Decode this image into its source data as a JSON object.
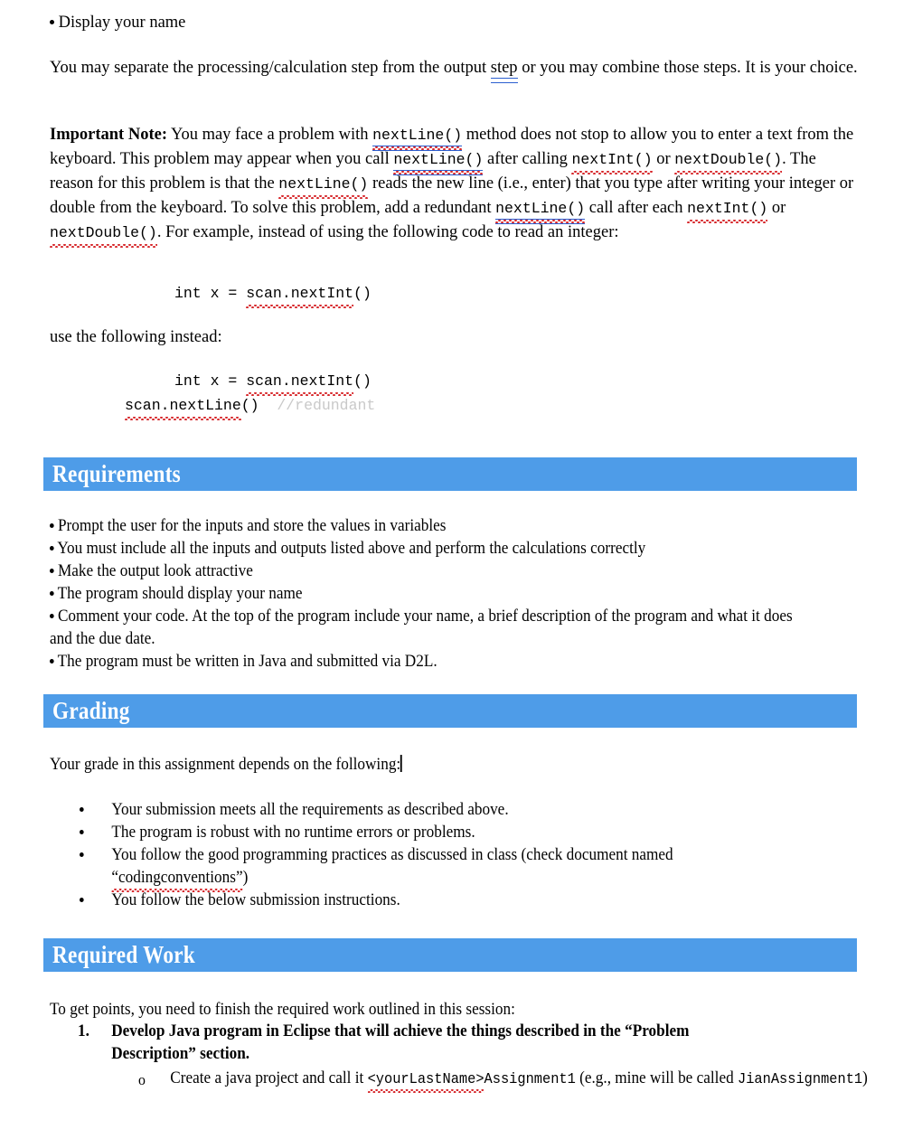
{
  "document": {
    "top_bullet": "Display your name",
    "para_separate": {
      "part1": "You may separate the processing/calculation step from the output ",
      "grammar_word": "step",
      "part2": " or you may combine those steps. It is your choice."
    },
    "important_note": {
      "label": "Important Note:",
      "t1": " You may face a problem with ",
      "c1": "nextLine()",
      "t2": " method does not stop to allow you to enter a text from the keyboard. This problem may appear when you call ",
      "c2": "nextLine()",
      "t3": " after calling ",
      "c3": "nextInt()",
      "t4": " or ",
      "c4": "nextDouble()",
      "t5": ".  The reason for this problem is that the ",
      "c5": "nextLine()",
      "t6": " reads the new line (i.e., enter) that you type after writing your integer or double from the keyboard. To solve this problem, add a redundant ",
      "c6": "nextLine()",
      "t7": " call after each ",
      "c7": "nextInt()",
      "t8": " or ",
      "c8": "nextDouble()",
      "t9": ". For example, instead of using the following code to read an integer:"
    },
    "code_block_1": {
      "prefix": "int x = ",
      "call": "scan.nextInt",
      "suffix": "()"
    },
    "use_instead_label": "use the following instead:",
    "code_block_2": {
      "line1_prefix": "int x = ",
      "line1_call": "scan.nextInt",
      "line1_suffix": "()",
      "line2_call": "scan.nextLine",
      "line2_suffix": "()",
      "line2_comment": "//redundant"
    },
    "sections": [
      {
        "id": "requirements",
        "heading": "Requirements",
        "bullets": [
          "Prompt the user for the inputs and store the values in variables",
          "You must include all the inputs and outputs listed above and perform the calculations correctly",
          "Make the output look attractive",
          "The program should display your name",
          "Comment your code. At the top of the program include your name, a brief description of the program and what it does and the due date.",
          "The program must be written in Java and submitted via D2L."
        ]
      },
      {
        "id": "grading",
        "heading": "Grading",
        "intro": "Your grade in this assignment depends on the following:",
        "bullets": [
          "Your submission meets all the requirements as described above.",
          "The program is robust with no runtime errors or problems.",
          "You follow the good programming practices as discussed in class (check document named",
          "You follow the below submission instructions."
        ],
        "bullet3_quoted": "“codingconventions”",
        "bullet3_tail": ")"
      },
      {
        "id": "required-work",
        "heading": "Required Work",
        "intro": "To get points, you need to finish the required work outlined in this session:",
        "item1_number": "1.",
        "item1_line1": "Develop Java program in Eclipse that will achieve the things described in the “Problem",
        "item1_line2": "Description” section.",
        "sub_marker": "o",
        "sub_pre": "Create a java project and call it ",
        "sub_code_spell": "<yourLastName>",
        "sub_code_rest": "Assignment1",
        "sub_mid": " (e.g., mine will be called ",
        "sub_code2": "JianAssignment1",
        "sub_tail": ")"
      }
    ]
  },
  "colors": {
    "banner_blue": "#4e9ce8",
    "banner_text": "#ffffff",
    "spellcheck_red": "#d6262a",
    "grammar_blue": "#2c5fd0",
    "comment_gray": "#c9c9c9",
    "body_text": "#000000"
  }
}
